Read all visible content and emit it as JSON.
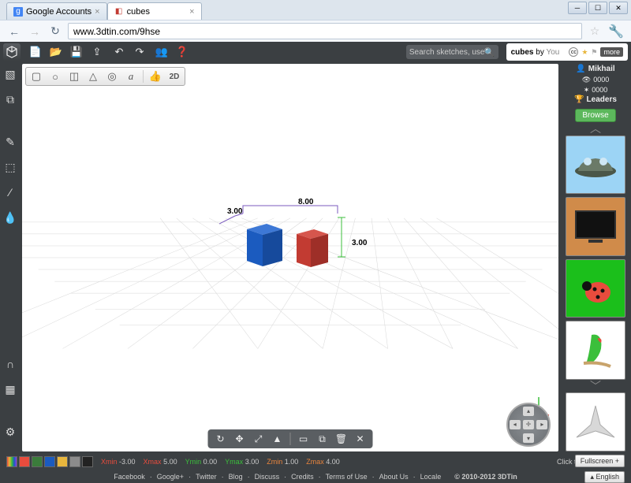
{
  "browser": {
    "tabs": [
      {
        "label": "Google Accounts",
        "favicon": "g"
      },
      {
        "label": "cubes",
        "favicon": "◧"
      }
    ],
    "url": "www.3dtin.com/9hse"
  },
  "app": {
    "search_placeholder": "Search sketches, users...",
    "title_name": "cubes",
    "title_by": "by",
    "title_owner": "You",
    "more_label": "more"
  },
  "shapes": {
    "text_tool": "a",
    "dim_2d": "2D"
  },
  "dimensions": {
    "width": "3.00",
    "length": "8.00",
    "height": "3.00"
  },
  "coords": {
    "xmin_label": "Xmin",
    "xmin": "-3.00",
    "xmax_label": "Xmax",
    "xmax": "5.00",
    "ymin_label": "Ymin",
    "ymin": "0.00",
    "ymax_label": "Ymax",
    "ymax": "3.00",
    "zmin_label": "Zmin",
    "zmin": "1.00",
    "zmax_label": "Zmax",
    "zmax": "4.00"
  },
  "palette": [
    "#e84c3d",
    "#3b7c3b",
    "#1b5bbf",
    "#e8b63d",
    "#8c8c8c",
    "#222222"
  ],
  "rainbow": "linear-gradient(90deg,#e84c3d,#e8b63d,#3bbf3b,#1b5bbf,#8c3de8)",
  "right": {
    "user": "Mikhail",
    "stat1": "0000",
    "stat2": "0000",
    "leaders": "Leaders",
    "browse": "Browse"
  },
  "footer": {
    "open_controls": "Click to open controls",
    "links": [
      "Facebook",
      "Google+",
      "Twitter",
      "Blog",
      "Discuss",
      "Credits",
      "Terms of Use",
      "About Us",
      "Locale"
    ],
    "copyright": "© 2010-2012 3DTin",
    "language": "English",
    "fullscreen": "Fullscreen +"
  },
  "colors": {
    "blue_cube": "#1b5bbf",
    "blue_cube_side": "#164a9c",
    "blue_cube_top": "#3d78d6",
    "red_cube": "#c23b32",
    "red_cube_side": "#9e2f28",
    "red_cube_top": "#d6564d",
    "thumbs": {
      "car_bg": "#9cd4f5",
      "bug_bg": "#1bbf1b",
      "tv_bg": "#d08b4a",
      "parrot_bg": "#ffffff",
      "ship_bg": "#ffffff"
    }
  }
}
